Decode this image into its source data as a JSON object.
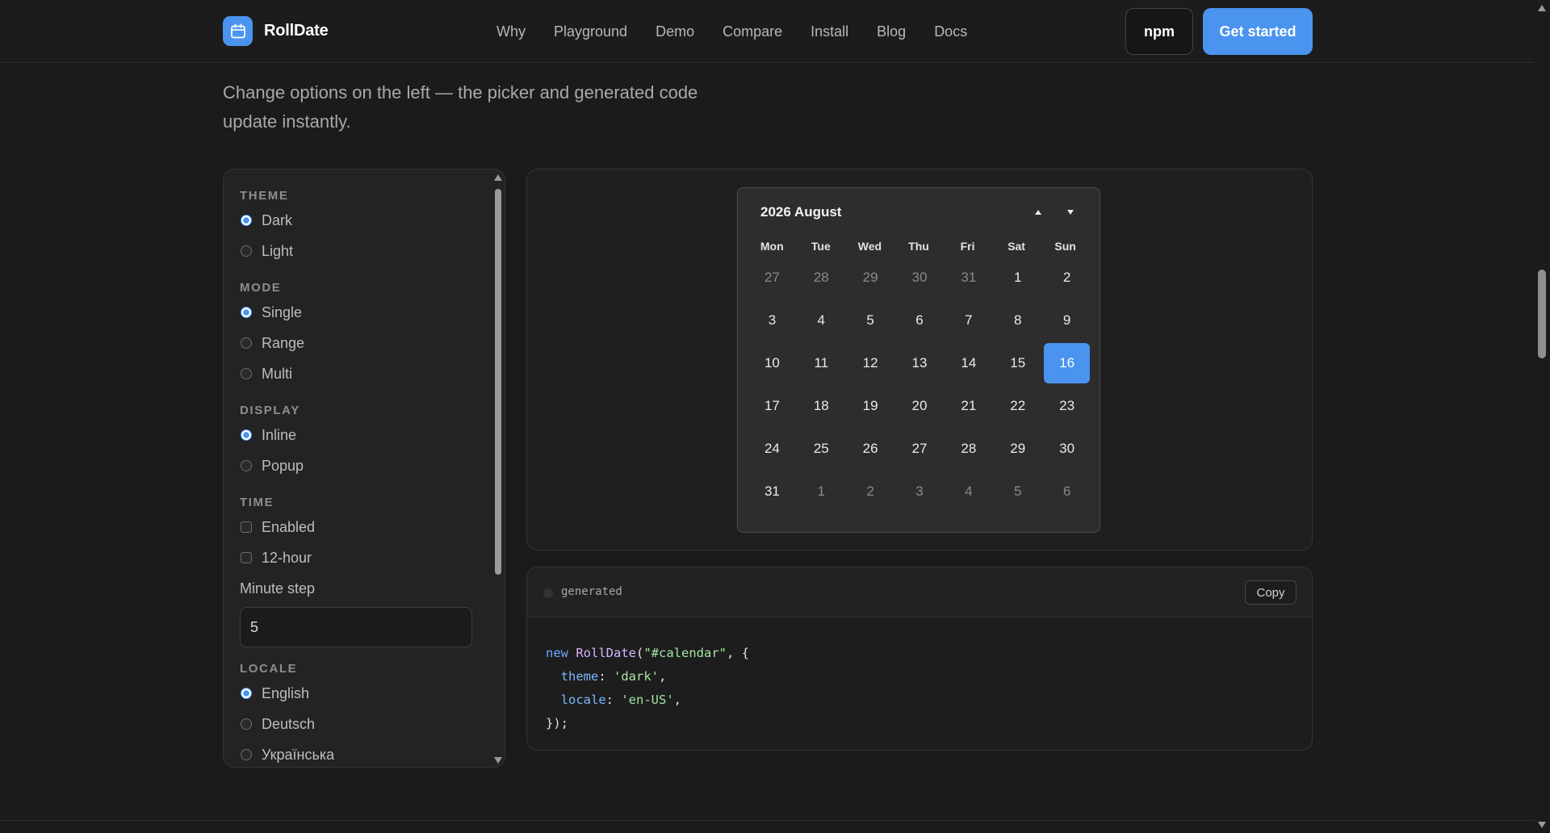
{
  "brand": {
    "name": "RollDate",
    "icon": "calendar-icon",
    "accent": "#4a94f0"
  },
  "nav": {
    "items": [
      "Why",
      "Playground",
      "Demo",
      "Compare",
      "Install",
      "Blog",
      "Docs"
    ],
    "npm_label": "npm",
    "cta_label": "Get started"
  },
  "intro": {
    "text": "Change options on the left — the picker and generated code update instantly."
  },
  "options": {
    "theme": {
      "title": "THEME",
      "choices": [
        "Dark",
        "Light"
      ],
      "selected": "Dark"
    },
    "mode": {
      "title": "MODE",
      "choices": [
        "Single",
        "Range",
        "Multi"
      ],
      "selected": "Single"
    },
    "display": {
      "title": "DISPLAY",
      "choices": [
        "Inline",
        "Popup"
      ],
      "selected": "Inline"
    },
    "time": {
      "title": "TIME",
      "checks": [
        "Enabled",
        "12-hour"
      ],
      "minute_step_label": "Minute step",
      "minute_step_value": "5"
    },
    "locale": {
      "title": "LOCALE",
      "choices": [
        "English",
        "Deutsch",
        "Українська"
      ],
      "selected": "English"
    }
  },
  "calendar": {
    "title": "2026 August",
    "weekdays": [
      "Mon",
      "Tue",
      "Wed",
      "Thu",
      "Fri",
      "Sat",
      "Sun"
    ],
    "days": [
      {
        "d": "27",
        "muted": true
      },
      {
        "d": "28",
        "muted": true
      },
      {
        "d": "29",
        "muted": true
      },
      {
        "d": "30",
        "muted": true
      },
      {
        "d": "31",
        "muted": true
      },
      {
        "d": "1"
      },
      {
        "d": "2"
      },
      {
        "d": "3"
      },
      {
        "d": "4"
      },
      {
        "d": "5"
      },
      {
        "d": "6"
      },
      {
        "d": "7"
      },
      {
        "d": "8"
      },
      {
        "d": "9"
      },
      {
        "d": "10"
      },
      {
        "d": "11"
      },
      {
        "d": "12"
      },
      {
        "d": "13"
      },
      {
        "d": "14"
      },
      {
        "d": "15"
      },
      {
        "d": "16",
        "selected": true
      },
      {
        "d": "17"
      },
      {
        "d": "18"
      },
      {
        "d": "19"
      },
      {
        "d": "20"
      },
      {
        "d": "21"
      },
      {
        "d": "22"
      },
      {
        "d": "23"
      },
      {
        "d": "24"
      },
      {
        "d": "25"
      },
      {
        "d": "26"
      },
      {
        "d": "27"
      },
      {
        "d": "28"
      },
      {
        "d": "29"
      },
      {
        "d": "30"
      },
      {
        "d": "31"
      },
      {
        "d": "1",
        "muted": true
      },
      {
        "d": "2",
        "muted": true
      },
      {
        "d": "3",
        "muted": true
      },
      {
        "d": "4",
        "muted": true
      },
      {
        "d": "5",
        "muted": true
      },
      {
        "d": "6",
        "muted": true
      }
    ]
  },
  "code": {
    "label": "generated",
    "copy_label": "Copy",
    "lines": [
      [
        {
          "t": "new ",
          "c": "kw"
        },
        {
          "t": "RollDate",
          "c": "fn"
        },
        {
          "t": "(",
          "c": ""
        },
        {
          "t": "\"#calendar\"",
          "c": "str"
        },
        {
          "t": ", {",
          "c": ""
        }
      ],
      [
        {
          "t": "  ",
          "c": ""
        },
        {
          "t": "theme",
          "c": "prop"
        },
        {
          "t": ": ",
          "c": ""
        },
        {
          "t": "'dark'",
          "c": "str"
        },
        {
          "t": ",",
          "c": ""
        }
      ],
      [
        {
          "t": "  ",
          "c": ""
        },
        {
          "t": "locale",
          "c": "prop"
        },
        {
          "t": ": ",
          "c": ""
        },
        {
          "t": "'en-US'",
          "c": "str"
        },
        {
          "t": ",",
          "c": ""
        }
      ],
      [
        {
          "t": "});",
          "c": ""
        }
      ]
    ]
  }
}
